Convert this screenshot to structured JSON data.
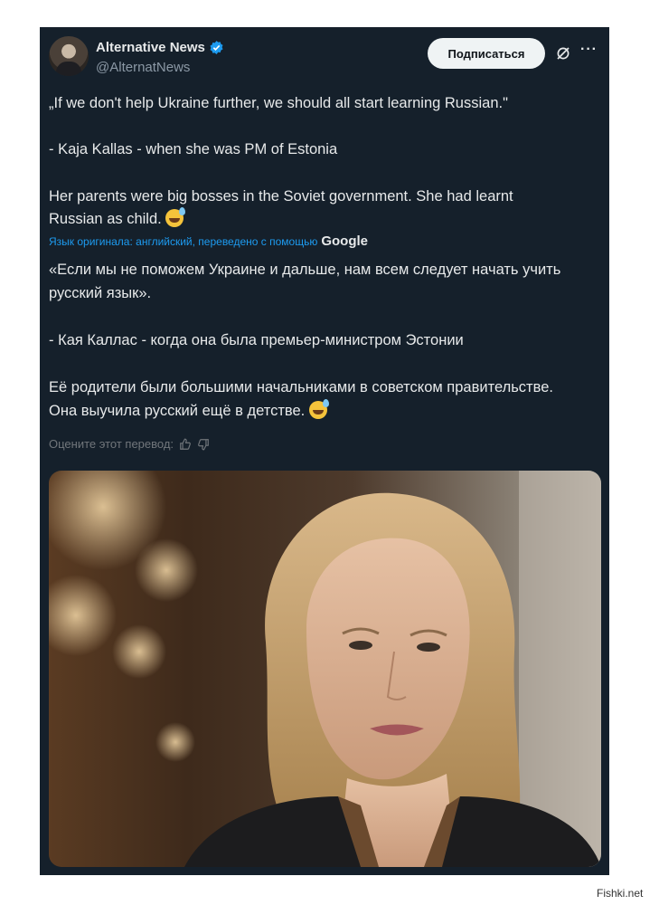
{
  "tweet": {
    "author_name": "Alternative News",
    "author_handle": "@AlternatNews",
    "subscribe_label": "Подписаться",
    "more_label": "···",
    "original_lines": [
      "„If we don't help Ukraine further, we should all start learning Russian.\"",
      "- Kaja Kallas - when she was PM of Estonia",
      "Her parents were big bosses in the Soviet government. She had learnt",
      "Russian as child."
    ],
    "translation_note": "Язык оригинала: английский, переведено с помощью",
    "translation_provider": "Google",
    "translated_lines": [
      "«Если мы не поможем Украине и дальше, нам всем следует начать учить",
      "русский язык».",
      "- Кая Каллас - когда она была премьер-министром Эстонии",
      "Её родители были большими начальниками в советском правительстве.",
      "Она выучила русский ещё в детстве."
    ],
    "rate_label": "Оцените этот перевод:"
  },
  "watermark": "Fishki.net",
  "colors": {
    "card_bg": "#15202b",
    "text": "#e7e9ea",
    "muted": "#8b98a5",
    "link": "#1d9bf0",
    "verified": "#1d9bf0"
  },
  "icons": [
    "verified-badge-icon",
    "grok-icon",
    "more-icon",
    "emoji-sweat-smile-icon",
    "thumb-up-icon",
    "thumb-down-icon"
  ]
}
